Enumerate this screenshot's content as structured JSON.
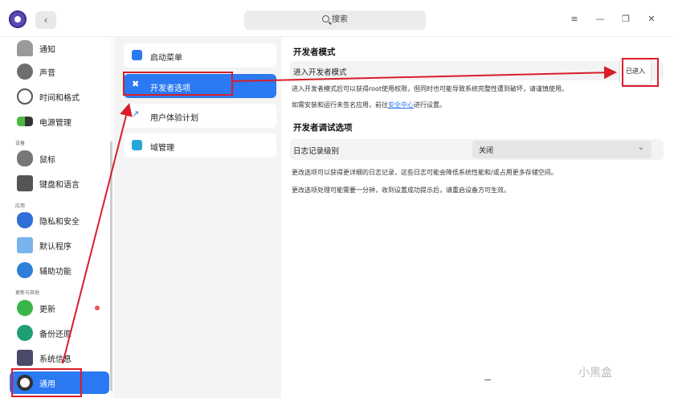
{
  "titlebar": {
    "search_placeholder": "搜索",
    "back_glyph": "‹",
    "menu_glyph": "≡",
    "min_glyph": "—",
    "max_glyph": "❐",
    "close_glyph": "✕"
  },
  "sidebar": {
    "items": [
      {
        "label": "通知",
        "icon": "bell-icon"
      },
      {
        "label": "声音",
        "icon": "speaker-icon"
      },
      {
        "label": "时间和格式",
        "icon": "clock-icon"
      },
      {
        "label": "电源管理",
        "icon": "battery-icon"
      },
      {
        "label": "鼠标",
        "icon": "mouse-icon"
      },
      {
        "label": "键盘和语言",
        "icon": "keyboard-icon"
      },
      {
        "label": "隐私和安全",
        "icon": "shield-icon"
      },
      {
        "label": "默认程序",
        "icon": "default-apps-icon"
      },
      {
        "label": "辅助功能",
        "icon": "accessibility-icon"
      },
      {
        "label": "更新",
        "icon": "update-icon"
      },
      {
        "label": "备份还原",
        "icon": "backup-icon"
      },
      {
        "label": "系统信息",
        "icon": "system-info-icon"
      },
      {
        "label": "通用",
        "icon": "general-icon",
        "active": true
      }
    ],
    "groups": {
      "devices": "设备",
      "apps": "应用",
      "update_other": "更新与其他"
    }
  },
  "middle": {
    "items": [
      {
        "label": "启动菜单",
        "icon": "boot-menu-icon"
      },
      {
        "label": "开发者选项",
        "icon": "developer-tools-icon",
        "active": true
      },
      {
        "label": "用户体验计划",
        "icon": "chart-trend-icon"
      },
      {
        "label": "域管理",
        "icon": "domain-icon"
      }
    ]
  },
  "content": {
    "dev_mode_title": "开发者模式",
    "enter_dev_mode_label": "进入开发者模式",
    "entered_button": "已进入",
    "dev_mode_note": "进入开发者模式后可以获得root使用权限，但同时也可能导致系统完整性遭到破坏，请谨慎使用。",
    "install_note_prefix": "如需安装和运行未签名应用，前往",
    "install_note_link": "安全中心",
    "install_note_suffix": "进行设置。",
    "debug_title": "开发者调试选项",
    "log_level_label": "日志记录级别",
    "log_level_value": "关闭",
    "debug_note_1": "更改选项可以获得更详细的日志记录，这些日志可能会降低系统性能和/或占用更多存储空间。",
    "debug_note_2": "更改选项处理可能需要一分钟，收到设置成功提示后，请重启设备方可生效。"
  },
  "watermark": "小黑盒",
  "colors": {
    "accent": "#2b79f3",
    "annotation_red": "#d81e2a"
  }
}
